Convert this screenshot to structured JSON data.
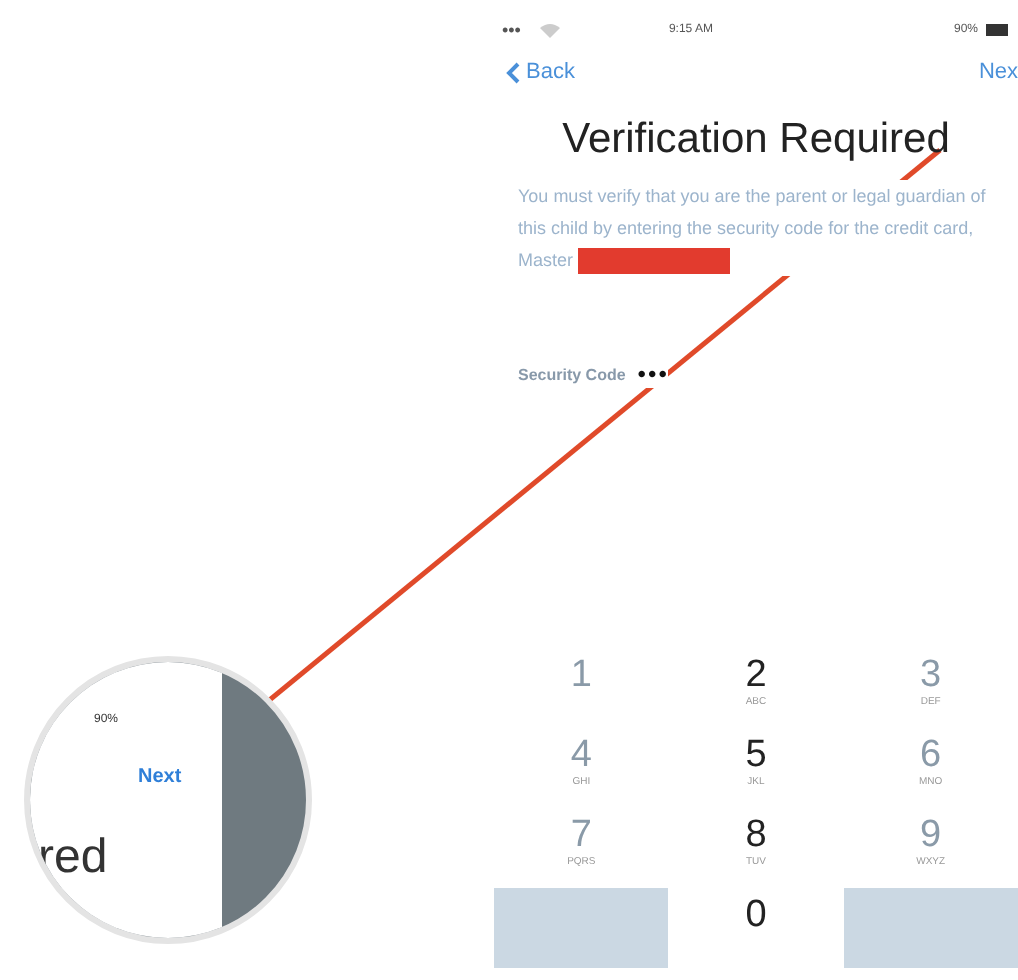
{
  "status_bar": {
    "signal": "•••",
    "time": "9:15 AM",
    "battery": "90%"
  },
  "nav": {
    "back": "Back",
    "next": "Nex"
  },
  "title": "Verification Required",
  "message": "You must verify that you are the parent or legal guardian of this child by entering the security code for the credit card, Master",
  "field": {
    "label": "Security Code",
    "value": "•••"
  },
  "keypad": [
    {
      "digit": "1"
    },
    {
      "digit": "2",
      "letters": "ABC"
    },
    {
      "digit": "3",
      "letters": "DEF"
    },
    {
      "digit": "4",
      "letters": "GHI"
    },
    {
      "digit": "5",
      "letters": "JKL"
    },
    {
      "digit": "6",
      "letters": "MNO"
    },
    {
      "digit": "7",
      "letters": "PQRS"
    },
    {
      "digit": "8",
      "letters": "TUV"
    },
    {
      "digit": "9",
      "letters": "WXYZ"
    },
    {
      "digit": "0"
    }
  ],
  "magnifier": {
    "battery": "90%",
    "next": "Next",
    "title_fragment": "red"
  }
}
